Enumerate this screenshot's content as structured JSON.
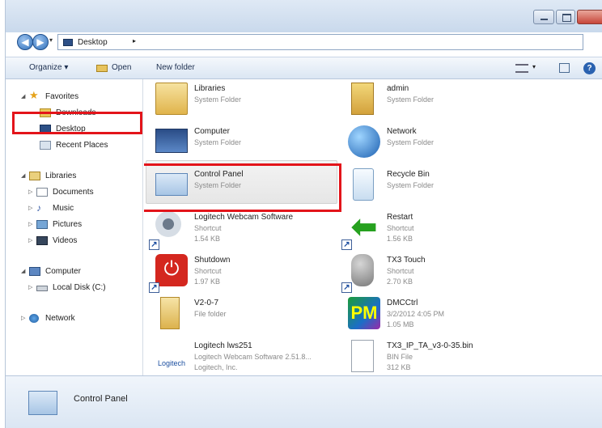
{
  "address": {
    "location": "Desktop",
    "separator": "▸"
  },
  "toolbar": {
    "organize": "Organize ▾",
    "open": "Open",
    "new_folder": "New folder"
  },
  "nav": {
    "favorites": "Favorites",
    "downloads": "Downloads",
    "desktop": "Desktop",
    "recent": "Recent Places",
    "libraries": "Libraries",
    "documents": "Documents",
    "music": "Music",
    "pictures": "Pictures",
    "videos": "Videos",
    "computer": "Computer",
    "local_disk": "Local Disk (C:)",
    "network": "Network"
  },
  "items": [
    {
      "name": "Libraries",
      "type": "System Folder",
      "size": "",
      "icon": "libraries-icon"
    },
    {
      "name": "admin",
      "type": "System Folder",
      "size": "",
      "icon": "user-folder-icon"
    },
    {
      "name": "Computer",
      "type": "System Folder",
      "size": "",
      "icon": "computer-icon"
    },
    {
      "name": "Network",
      "type": "System Folder",
      "size": "",
      "icon": "network-icon"
    },
    {
      "name": "Control Panel",
      "type": "System Folder",
      "size": "",
      "icon": "control-panel-icon"
    },
    {
      "name": "Recycle Bin",
      "type": "System Folder",
      "size": "",
      "icon": "recycle-bin-icon"
    },
    {
      "name": "Logitech Webcam Software",
      "type": "Shortcut",
      "size": "1.54 KB",
      "icon": "webcam-icon"
    },
    {
      "name": "Restart",
      "type": "Shortcut",
      "size": "1.56 KB",
      "icon": "restart-arrow-icon"
    },
    {
      "name": "Shutdown",
      "type": "Shortcut",
      "size": "1.97 KB",
      "icon": "power-icon"
    },
    {
      "name": "TX3 Touch",
      "type": "Shortcut",
      "size": "2.70 KB",
      "icon": "keys-icon"
    },
    {
      "name": "V2-0-7",
      "type": "File folder",
      "size": "",
      "icon": "folder-icon"
    },
    {
      "name": "DMCCtrl",
      "type": "3/2/2012 4:05 PM",
      "size": "1.05 MB",
      "icon": "dmc-app-icon"
    },
    {
      "name": "Logitech lws251",
      "type": "Logitech Webcam Software 2.51.8...",
      "size": "Logitech, Inc.",
      "icon": "logitech-logo-icon"
    },
    {
      "name": "TX3_IP_TA_v3-0-35.bin",
      "type": "BIN File",
      "size": "312 KB",
      "icon": "bin-file-icon"
    }
  ],
  "details": {
    "name": "Control Panel"
  },
  "glyphs": {
    "back": "◀",
    "forward": "▶",
    "dropdown": "▾",
    "refresh": "↻",
    "help": "?",
    "shortcut": "↗"
  }
}
